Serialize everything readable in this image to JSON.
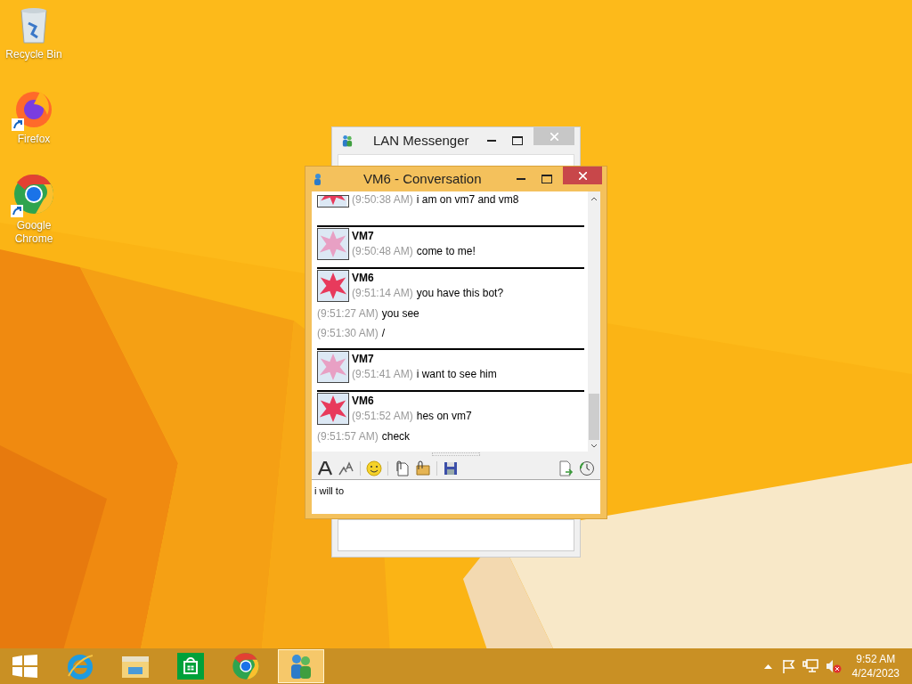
{
  "desktop_icons": [
    {
      "label": "Recycle Bin",
      "kind": "bin",
      "shortcut": false
    },
    {
      "label": "Firefox",
      "kind": "firefox",
      "shortcut": true
    },
    {
      "label": "Google Chrome",
      "kind": "chrome",
      "shortcut": true
    }
  ],
  "back_window": {
    "title": "LAN Messenger"
  },
  "conversation": {
    "title": "VM6 - Conversation",
    "messages": [
      {
        "kind": "cut",
        "color": "#e83a5c",
        "time": "(9:50:38 AM)",
        "text": "i am on vm7 and vm8"
      },
      {
        "kind": "header",
        "color": "#e8a0c4",
        "sender": "VM7",
        "time": "(9:50:48 AM)",
        "text": "come to me!"
      },
      {
        "kind": "header",
        "color": "#e83a5c",
        "sender": "VM6",
        "time": "(9:51:14 AM)",
        "text": "you have this bot?"
      },
      {
        "kind": "line",
        "time": "(9:51:27 AM)",
        "text": "you see"
      },
      {
        "kind": "line",
        "time": "(9:51:30 AM)",
        "text": "/"
      },
      {
        "kind": "header",
        "color": "#e8a0c4",
        "sender": "VM7",
        "time": "(9:51:41 AM)",
        "text": "i want to see him"
      },
      {
        "kind": "header",
        "color": "#e83a5c",
        "sender": "VM6",
        "time": "(9:51:52 AM)",
        "text": "hes on vm7"
      },
      {
        "kind": "line",
        "time": "(9:51:57 AM)",
        "text": "check"
      }
    ],
    "input": {
      "value": "i will to"
    }
  },
  "taskbar": {
    "apps": [
      {
        "kind": "start",
        "selected": false
      },
      {
        "kind": "ie",
        "selected": false
      },
      {
        "kind": "explorer",
        "selected": false
      },
      {
        "kind": "store",
        "selected": false
      },
      {
        "kind": "chrome",
        "selected": false
      },
      {
        "kind": "messenger",
        "selected": true
      }
    ],
    "tray": {
      "time": "9:52 AM",
      "date": "4/24/2023",
      "muted": true
    }
  }
}
